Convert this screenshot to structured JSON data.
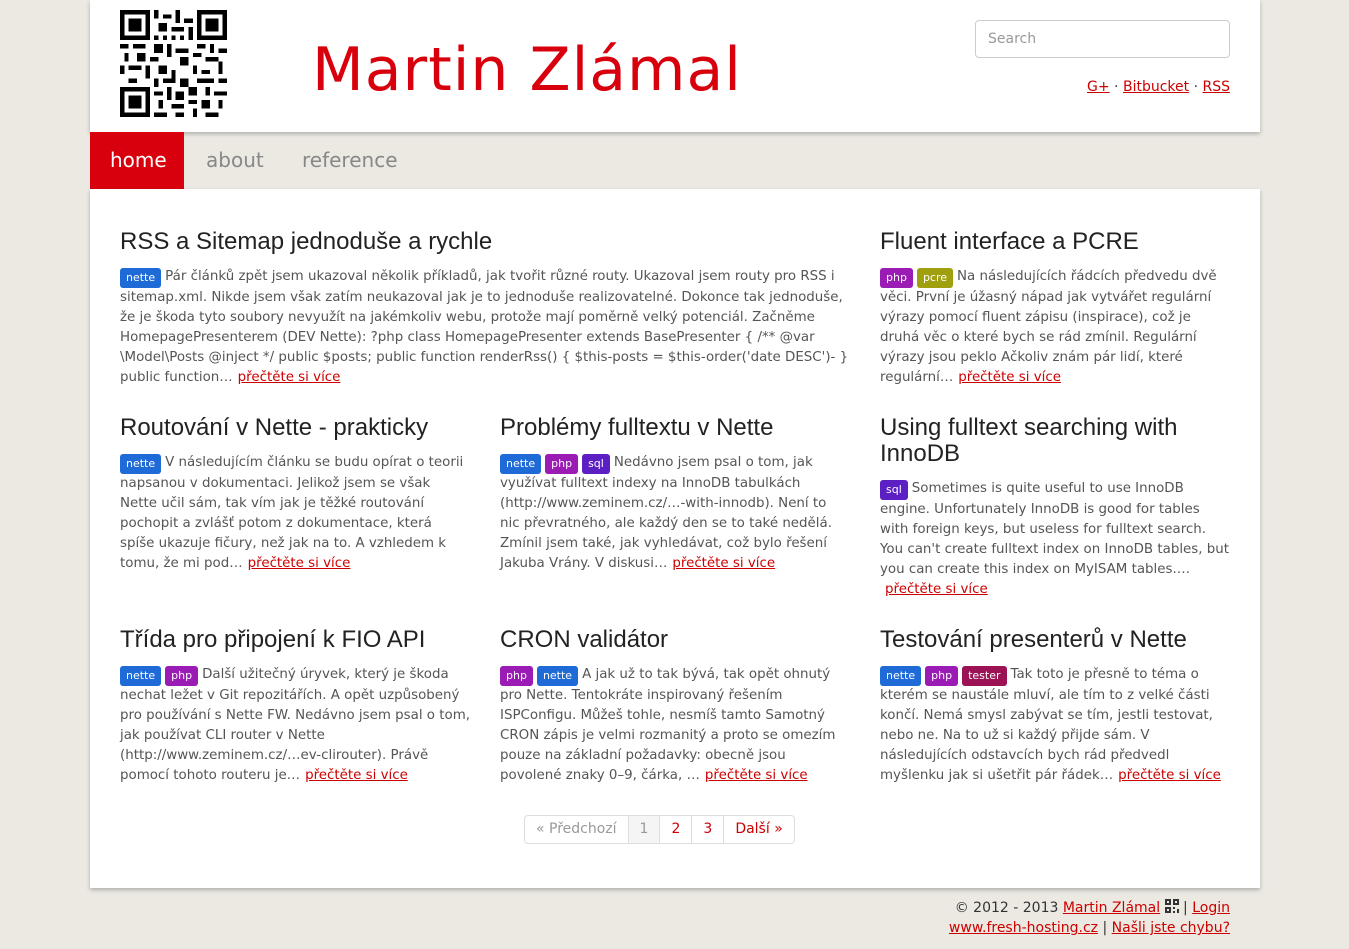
{
  "header": {
    "site_title": "Martin Zlámal",
    "search_placeholder": "Search",
    "social": [
      "G+",
      "Bitbucket",
      "RSS"
    ]
  },
  "nav": [
    {
      "label": "home",
      "active": true
    },
    {
      "label": "about",
      "active": false
    },
    {
      "label": "reference",
      "active": false
    }
  ],
  "tag_colors": {
    "nette": "#1e6ad7",
    "php": "#9b1bb5",
    "sql": "#5c1fc4",
    "pcre": "#a0a00e",
    "tester": "#9b1355"
  },
  "articles": [
    {
      "title": "RSS a Sitemap jednoduše a rychle",
      "tags": [
        "nette"
      ],
      "excerpt": "Pár článků zpět jsem ukazoval několik příkladů, jak tvořit různé routy. Ukazoval jsem routy pro RSS i sitemap.xml. Nikde jsem však zatím neukazoval jak je to jednoduše realizovatelné. Dokonce tak jednoduše, že je škoda tyto soubory nevyužít na jakémkoliv webu, protože mají poměrně velký potenciál. Začněme HomepagePresenterem (DEV Nette): ?php class HomepagePresenter extends BasePresenter { /** @var \\Model\\Posts @inject */ public $posts; public function renderRss() { $this-posts = $this-order('date DESC')- } public function…",
      "more": "přečtěte si více"
    },
    {
      "title": "Fluent interface a PCRE",
      "tags": [
        "php",
        "pcre"
      ],
      "excerpt": "Na následujících řádcích předvedu dvě věci. První je úžasný nápad jak vytvářet regulární výrazy pomocí fluent zápisu (inspirace), což je druhá věc o které bych se rád zmínil. Regulární výrazy jsou peklo Ačkoliv znám pár lidí, které regulární…",
      "more": "přečtěte si více"
    },
    {
      "title": "Routování v Nette - prakticky",
      "tags": [
        "nette"
      ],
      "excerpt": "V následujícím článku se budu opírat o teorii napsanou v dokumentaci. Jelikož jsem se však Nette učil sám, tak vím jak je těžké routování pochopit a zvlášť potom z dokumentace, která spíše ukazuje fičury, než jak na to. A vzhledem k tomu, že mi pod…",
      "more": "přečtěte si více"
    },
    {
      "title": "Problémy fulltextu v Nette",
      "tags": [
        "nette",
        "php",
        "sql"
      ],
      "excerpt": "Nedávno jsem psal o tom, jak využívat fulltext indexy na InnoDB tabulkách (http://www.zeminem.cz/…-with-innodb). Není to nic převratného, ale každý den se to také nedělá. Zmínil jsem také, jak vyhledávat, což bylo řešení Jakuba Vrány. V diskusi…",
      "more": "přečtěte si více"
    },
    {
      "title": "Using fulltext searching with InnoDB",
      "tags": [
        "sql"
      ],
      "excerpt": "Sometimes is quite useful to use InnoDB engine. Unfortunately InnoDB is good for tables with foreign keys, but useless for fulltext search. You can't create fulltext index on InnoDB tables, but you can create this index on MyISAM tables.…",
      "more": "přečtěte si více"
    },
    {
      "title": "Třída pro připojení k FIO API",
      "tags": [
        "nette",
        "php"
      ],
      "excerpt": "Další užitečný úryvek, který je škoda nechat ležet v Git repozitářích. A opět uzpůsobený pro používání s Nette FW. Nedávno jsem psal o tom, jak používat CLI router v Nette (http://www.zeminem.cz/…ev-clirouter). Právě pomocí tohoto routeru je…",
      "more": "přečtěte si více"
    },
    {
      "title": "CRON validátor",
      "tags": [
        "php",
        "nette"
      ],
      "excerpt": "A jak už to tak bývá, tak opět ohnutý pro Nette. Tentokráte inspirovaný řešením ISPConfigu. Můžeš tohle, nesmíš tamto Samotný CRON zápis je velmi rozmanitý a proto se omezím pouze na základní požadavky: obecně jsou povolené znaky 0–9, čárka, …",
      "more": "přečtěte si více"
    },
    {
      "title": "Testování presenterů v Nette",
      "tags": [
        "nette",
        "php",
        "tester"
      ],
      "excerpt": "Tak toto je přesně to téma o kterém se naustále mluví, ale tím to z velké části končí. Nemá smysl zabývat se tím, jestli testovat, nebo ne. Na to už si každý přijde sám. V následujících odstavcích bych rád předvedl myšlenku jak si ušetřit pár řádek…",
      "more": "přečtěte si více"
    }
  ],
  "pagination": [
    "« Předchozí",
    "1",
    "2",
    "3",
    "Další »"
  ],
  "footer": {
    "copyright": "© 2012 - 2013",
    "author": "Martin Zlámal",
    "login": "Login",
    "hosting": "www.fresh-hosting.cz",
    "bug": "Našli jste chybu?"
  }
}
